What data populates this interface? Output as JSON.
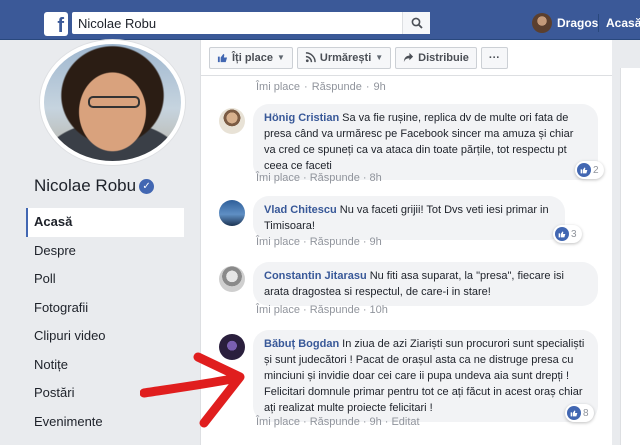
{
  "topbar": {
    "search_value": "Nicolae Robu",
    "user_name": "Dragos",
    "home_label": "Acasă",
    "colors": {
      "bar": "#3b5998"
    }
  },
  "page": {
    "name": "Nicolae Robu",
    "verified_icon": "verified-check-icon"
  },
  "nav": [
    {
      "label": "Acasă",
      "active": true
    },
    {
      "label": "Despre"
    },
    {
      "label": "Poll"
    },
    {
      "label": "Fotografii"
    },
    {
      "label": "Clipuri video"
    },
    {
      "label": "Notițe"
    },
    {
      "label": "Postări"
    },
    {
      "label": "Evenimente"
    }
  ],
  "actions": {
    "like": "Îți place",
    "follow": "Urmărești",
    "share": "Distribuie",
    "more": "···"
  },
  "top_meta": {
    "like": "Îmi place",
    "reply": "Răspunde",
    "time": "9h"
  },
  "comments": [
    {
      "author": "Hönig Cristian",
      "text": "Sa va fie rușine, replica dv de multe ori fata de presa când va urmăresc pe Facebook sincer ma amuza și chiar va cred ce spuneți ca va ataca din toate părțile, tot respectu pt ceea ce faceti",
      "like": "Îmi place",
      "reply": "Răspunde",
      "time": "8h",
      "reactions": "2"
    },
    {
      "author": "Vlad Chitescu",
      "text": "Nu va faceti grijii! Tot Dvs veti iesi primar in Timisoara!",
      "like": "Îmi place",
      "reply": "Răspunde",
      "time": "9h",
      "reactions": "3"
    },
    {
      "author": "Constantin Jitarasu",
      "text": "Nu fiti asa suparat, la \"presa\", fiecare isi arata dragostea si respectul, de care-i in stare!",
      "like": "Îmi place",
      "reply": "Răspunde",
      "time": "10h",
      "reactions": ""
    },
    {
      "author": "Băbuț Bogdan",
      "text": "In ziua de azi Ziariști sun procurori sunt specialiști și sunt judecători ! Pacat de orașul asta ca ne distruge presa cu minciuni și invidie doar cei care ii pupa undeva aia sunt drepți ! Felicitari domnule primar pentru tot ce ați făcut in acest oraș chiar ați realizat multe proiecte felicitari !",
      "like": "Îmi place",
      "reply": "Răspunde",
      "time": "9h",
      "edited": "Editat",
      "reactions": "8"
    }
  ]
}
